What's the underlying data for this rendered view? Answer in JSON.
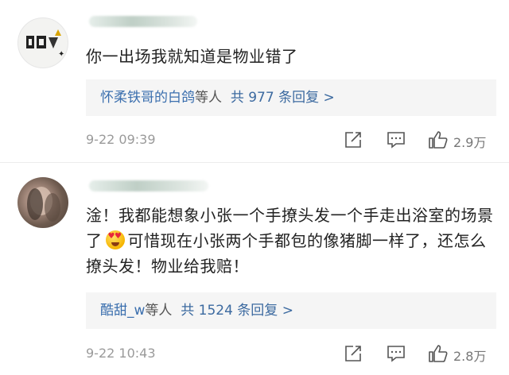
{
  "comments": [
    {
      "text": "你一出场我就知道是物业错了",
      "replies": {
        "names": "怀柔铁哥的白鸽",
        "suffix": "等人",
        "count_text": "共 977 条回复 >"
      },
      "time": "9-22 09:39",
      "likes": "2.9万"
    },
    {
      "text_before_emoji": "淦！我都能想象小张一个手撩头发一个手走出浴室的场景了",
      "emoji": "heart-eyes-emoji",
      "text_after_emoji": "可惜现在小张两个手都包的像猪脚一样了，还怎么撩头发！物业给我赔！",
      "replies": {
        "names": "酷甜_w",
        "suffix": "等人",
        "count_text": "共 1524 条回复 >"
      },
      "time": "9-22 10:43",
      "likes": "2.8万"
    }
  ],
  "icons": {
    "share": "edit-share-icon",
    "comment": "comment-bubble-icon",
    "like": "thumbs-up-icon"
  }
}
